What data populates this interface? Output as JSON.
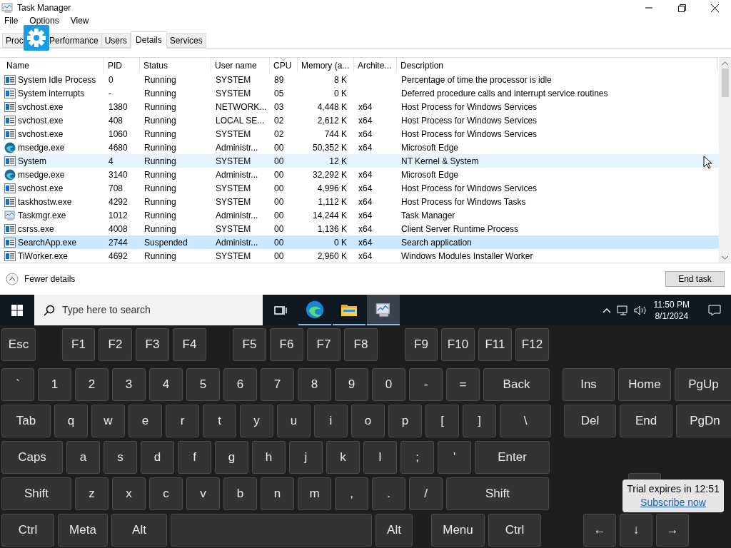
{
  "window": {
    "title": "Task Manager"
  },
  "menu": [
    "File",
    "Options",
    "View"
  ],
  "tabs": [
    {
      "label": "Proc",
      "selected": false
    },
    {
      "label": "Performance",
      "selected": false
    },
    {
      "label": "Users",
      "selected": false
    },
    {
      "label": "Details",
      "selected": true
    },
    {
      "label": "Services",
      "selected": false
    }
  ],
  "table": {
    "columns": [
      "Name",
      "PID",
      "Status",
      "User name",
      "CPU",
      "Memory (a...",
      "Archite...",
      "Description"
    ],
    "rows": [
      {
        "kind": "service",
        "cells": [
          "System Idle Process",
          "0",
          "Running",
          "SYSTEM",
          "89",
          "8 K",
          "",
          "Percentage of time the processor is idle"
        ],
        "selected": false,
        "hovered": false
      },
      {
        "kind": "service",
        "cells": [
          "System interrupts",
          "-",
          "Running",
          "SYSTEM",
          "05",
          "0 K",
          "",
          "Deferred procedure calls and interrupt service routines"
        ],
        "selected": false,
        "hovered": false
      },
      {
        "kind": "service",
        "cells": [
          "svchost.exe",
          "1380",
          "Running",
          "NETWORK...",
          "03",
          "4,448 K",
          "x64",
          "Host Process for Windows Services"
        ],
        "selected": false,
        "hovered": false
      },
      {
        "kind": "service",
        "cells": [
          "svchost.exe",
          "408",
          "Running",
          "LOCAL SE...",
          "02",
          "2,612 K",
          "x64",
          "Host Process for Windows Services"
        ],
        "selected": false,
        "hovered": false
      },
      {
        "kind": "service",
        "cells": [
          "svchost.exe",
          "1060",
          "Running",
          "SYSTEM",
          "02",
          "744 K",
          "x64",
          "Host Process for Windows Services"
        ],
        "selected": false,
        "hovered": false
      },
      {
        "kind": "edge",
        "cells": [
          "msedge.exe",
          "4680",
          "Running",
          "Administr...",
          "00",
          "50,352 K",
          "x64",
          "Microsoft Edge"
        ],
        "selected": false,
        "hovered": false
      },
      {
        "kind": "service",
        "cells": [
          "System",
          "4",
          "Running",
          "SYSTEM",
          "00",
          "12 K",
          "",
          "NT Kernel & System"
        ],
        "selected": false,
        "hovered": true
      },
      {
        "kind": "edge",
        "cells": [
          "msedge.exe",
          "3140",
          "Running",
          "Administr...",
          "00",
          "32,292 K",
          "x64",
          "Microsoft Edge"
        ],
        "selected": false,
        "hovered": false
      },
      {
        "kind": "service",
        "cells": [
          "svchost.exe",
          "708",
          "Running",
          "SYSTEM",
          "00",
          "4,996 K",
          "x64",
          "Host Process for Windows Services"
        ],
        "selected": false,
        "hovered": false
      },
      {
        "kind": "service",
        "cells": [
          "taskhostw.exe",
          "4292",
          "Running",
          "SYSTEM",
          "00",
          "1,112 K",
          "x64",
          "Host Process for Windows Tasks"
        ],
        "selected": false,
        "hovered": false
      },
      {
        "kind": "taskmgr",
        "cells": [
          "Taskmgr.exe",
          "1012",
          "Running",
          "Administr...",
          "00",
          "14,244 K",
          "x64",
          "Task Manager"
        ],
        "selected": false,
        "hovered": false
      },
      {
        "kind": "service",
        "cells": [
          "csrss.exe",
          "4008",
          "Running",
          "SYSTEM",
          "00",
          "1,136 K",
          "x64",
          "Client Server Runtime Process"
        ],
        "selected": false,
        "hovered": false
      },
      {
        "kind": "service",
        "cells": [
          "SearchApp.exe",
          "2744",
          "Suspended",
          "Administr...",
          "00",
          "0 K",
          "x64",
          "Search application"
        ],
        "selected": true,
        "hovered": false
      },
      {
        "kind": "service",
        "cells": [
          "TiWorker.exe",
          "4692",
          "Running",
          "SYSTEM",
          "00",
          "2,960 K",
          "x64",
          "Windows Modules Installer Worker"
        ],
        "selected": false,
        "hovered": false
      }
    ]
  },
  "footer": {
    "toggle": "Fewer details",
    "button": "End task"
  },
  "taskbar": {
    "search_placeholder": "Type here to search",
    "apps": [
      {
        "kind": "edge",
        "active": false
      },
      {
        "kind": "folder",
        "active": false
      },
      {
        "kind": "taskmgr",
        "active": true
      }
    ],
    "time": "11:50 PM",
    "date": "8/1/2024"
  },
  "keyboard": {
    "rows": [
      [
        {
          "label": "Esc"
        },
        {
          "label": "F1"
        },
        {
          "label": "F2"
        },
        {
          "label": "F3"
        },
        {
          "label": "F4"
        },
        {
          "label": "F5"
        },
        {
          "label": "F6"
        },
        {
          "label": "F7"
        },
        {
          "label": "F8"
        },
        {
          "label": "F9"
        },
        {
          "label": "F10"
        },
        {
          "label": "F11"
        },
        {
          "label": "F12"
        }
      ],
      [
        {
          "label": "`"
        },
        {
          "label": "1"
        },
        {
          "label": "2"
        },
        {
          "label": "3"
        },
        {
          "label": "4"
        },
        {
          "label": "5"
        },
        {
          "label": "6"
        },
        {
          "label": "7"
        },
        {
          "label": "8"
        },
        {
          "label": "9"
        },
        {
          "label": "0"
        },
        {
          "label": "-"
        },
        {
          "label": "="
        },
        {
          "label": "Back"
        },
        {
          "label": "Ins"
        },
        {
          "label": "Home"
        },
        {
          "label": "PgUp"
        }
      ],
      [
        {
          "label": "Tab"
        },
        {
          "label": "q"
        },
        {
          "label": "w"
        },
        {
          "label": "e"
        },
        {
          "label": "r"
        },
        {
          "label": "t"
        },
        {
          "label": "y"
        },
        {
          "label": "u"
        },
        {
          "label": "i"
        },
        {
          "label": "o"
        },
        {
          "label": "p"
        },
        {
          "label": "["
        },
        {
          "label": "]"
        },
        {
          "label": "\\"
        },
        {
          "label": "Del"
        },
        {
          "label": "End"
        },
        {
          "label": "PgDn"
        }
      ],
      [
        {
          "label": "Caps"
        },
        {
          "label": "a"
        },
        {
          "label": "s"
        },
        {
          "label": "d"
        },
        {
          "label": "f"
        },
        {
          "label": "g"
        },
        {
          "label": "h"
        },
        {
          "label": "j"
        },
        {
          "label": "k"
        },
        {
          "label": "l"
        },
        {
          "label": ";"
        },
        {
          "label": "'"
        },
        {
          "label": "Enter"
        }
      ],
      [
        {
          "label": "Shift"
        },
        {
          "label": "z"
        },
        {
          "label": "x"
        },
        {
          "label": "c"
        },
        {
          "label": "v"
        },
        {
          "label": "b"
        },
        {
          "label": "n"
        },
        {
          "label": "m"
        },
        {
          "label": ","
        },
        {
          "label": "."
        },
        {
          "label": "/"
        },
        {
          "label": "Shift"
        },
        {
          "kind": "covered"
        }
      ],
      [
        {
          "label": "Ctrl"
        },
        {
          "label": "Meta"
        },
        {
          "label": "Alt"
        },
        {
          "kind": "space"
        },
        {
          "label": "Alt"
        },
        {
          "label": "Menu"
        },
        {
          "label": "Ctrl"
        },
        {
          "label": "←"
        },
        {
          "label": "↓"
        },
        {
          "label": "→"
        }
      ]
    ]
  },
  "trial": {
    "message": "Trial expires in 12:51",
    "link": "Subscribe now"
  }
}
